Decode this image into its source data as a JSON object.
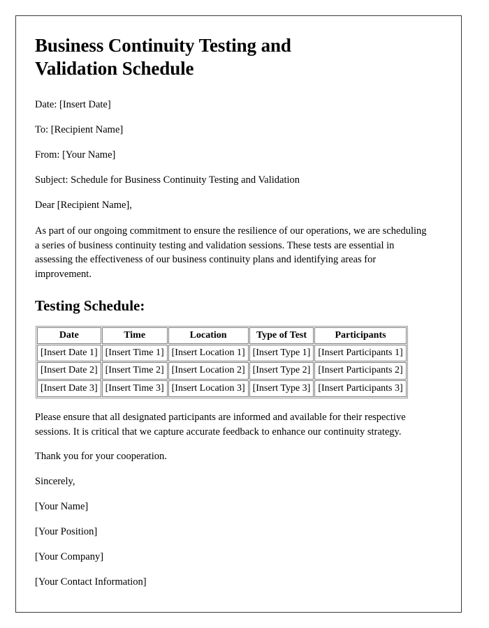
{
  "document": {
    "title": "Business Continuity Testing and Validation Schedule",
    "meta": [
      {
        "key": "date",
        "text": "Date: [Insert Date]"
      },
      {
        "key": "to",
        "text": "To: [Recipient Name]"
      },
      {
        "key": "from",
        "text": "From: [Your Name]"
      },
      {
        "key": "subject",
        "text": "Subject: Schedule for Business Continuity Testing and Validation"
      },
      {
        "key": "salutation",
        "text": "Dear [Recipient Name],"
      }
    ],
    "intro_paragraph": "As part of our ongoing commitment to ensure the resilience of our operations, we are scheduling a series of business continuity testing and validation sessions. These tests are essential in assessing the effectiveness of our business continuity plans and identifying areas for improvement.",
    "section_heading": "Testing Schedule:",
    "table": {
      "columns": [
        "Date",
        "Time",
        "Location",
        "Type of Test",
        "Participants"
      ],
      "rows": [
        [
          "[Insert Date 1]",
          "[Insert Time 1]",
          "[Insert Location 1]",
          "[Insert Type 1]",
          "[Insert Participants 1]"
        ],
        [
          "[Insert Date 2]",
          "[Insert Time 2]",
          "[Insert Location 2]",
          "[Insert Type 2]",
          "[Insert Participants 2]"
        ],
        [
          "[Insert Date 3]",
          "[Insert Time 3]",
          "[Insert Location 3]",
          "[Insert Type 3]",
          "[Insert Participants 3]"
        ]
      ]
    },
    "closing_paragraph": "Please ensure that all designated participants are informed and available for their respective sessions. It is critical that we capture accurate feedback to enhance our continuity strategy.",
    "thanks": "Thank you for your cooperation.",
    "signature": [
      {
        "key": "sign-off",
        "text": "Sincerely,"
      },
      {
        "key": "name",
        "text": "[Your Name]"
      },
      {
        "key": "position",
        "text": "[Your Position]"
      },
      {
        "key": "company",
        "text": "[Your Company]"
      },
      {
        "key": "contact",
        "text": "[Your Contact Information]"
      }
    ]
  }
}
